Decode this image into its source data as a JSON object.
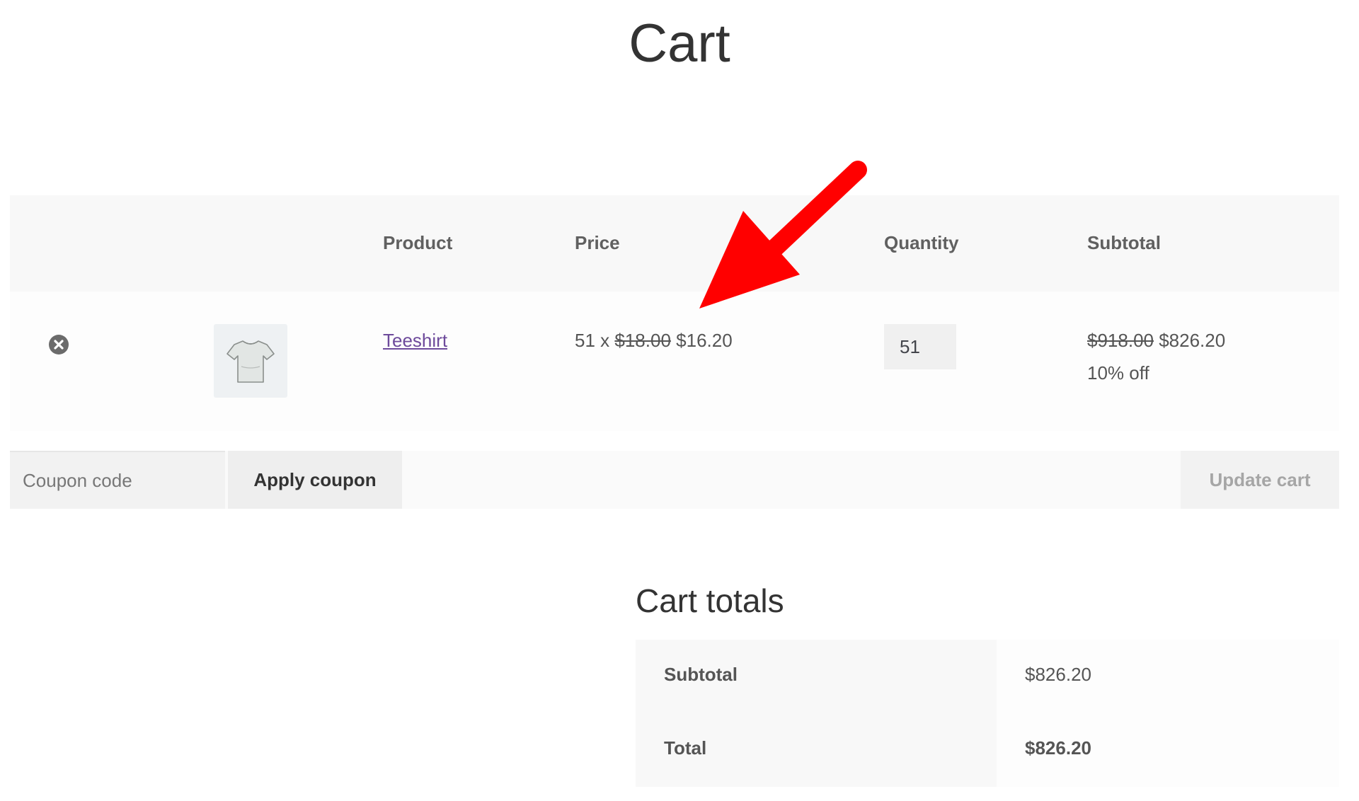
{
  "page": {
    "title": "Cart"
  },
  "cart": {
    "headers": {
      "product": "Product",
      "price": "Price",
      "quantity": "Quantity",
      "subtotal": "Subtotal"
    },
    "item": {
      "remove_icon": "remove-circle-x-icon",
      "thumbnail_icon": "tshirt-icon",
      "name": "Teeshirt",
      "price_qty_prefix": "51 x",
      "price_original": "$18.00",
      "price_sale": "$16.20",
      "quantity": "51",
      "subtotal_original": "$918.00",
      "subtotal_sale": "$826.20",
      "discount_note": "10% off"
    }
  },
  "actions": {
    "coupon_placeholder": "Coupon code",
    "apply_coupon_label": "Apply coupon",
    "update_cart_label": "Update cart"
  },
  "totals": {
    "title": "Cart totals",
    "rows": [
      {
        "label": "Subtotal",
        "value": "$826.20"
      },
      {
        "label": "Total",
        "value": "$826.20"
      }
    ]
  },
  "annotation": {
    "icon": "red-arrow-icon",
    "color": "#ff0000"
  }
}
